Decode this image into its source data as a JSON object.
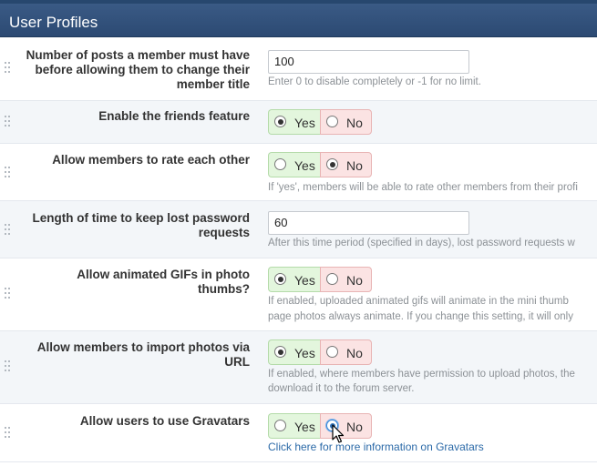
{
  "panel": {
    "title": "User Profiles"
  },
  "settings": [
    {
      "label": "Number of posts a member must have before allowing them to change their member title",
      "type": "text",
      "value": "100",
      "description": "Enter 0 to disable completely or -1 for no limit."
    },
    {
      "label": "Enable the friends feature",
      "type": "yesno",
      "selected": "yes"
    },
    {
      "label": "Allow members to rate each other",
      "type": "yesno",
      "selected": "no",
      "description": "If 'yes', members will be able to rate other members from their profi"
    },
    {
      "label": "Length of time to keep lost password requests",
      "type": "text",
      "value": "60",
      "description": "After this time period (specified in days), lost password requests w"
    },
    {
      "label": "Allow animated GIFs in photo thumbs?",
      "type": "yesno",
      "selected": "yes",
      "description_lines": [
        "If enabled, uploaded animated gifs will animate in the mini thumb",
        "page photos always animate. If you change this setting, it will only"
      ]
    },
    {
      "label": "Allow members to import photos via URL",
      "type": "yesno",
      "selected": "yes",
      "description_lines": [
        "If enabled, where members have permission to upload photos, the",
        "download it to the forum server."
      ]
    },
    {
      "label": "Allow users to use Gravatars",
      "type": "yesno",
      "selected": "no",
      "link": "Click here for more information on Gravatars"
    }
  ],
  "yes_label": "Yes",
  "no_label": "No"
}
